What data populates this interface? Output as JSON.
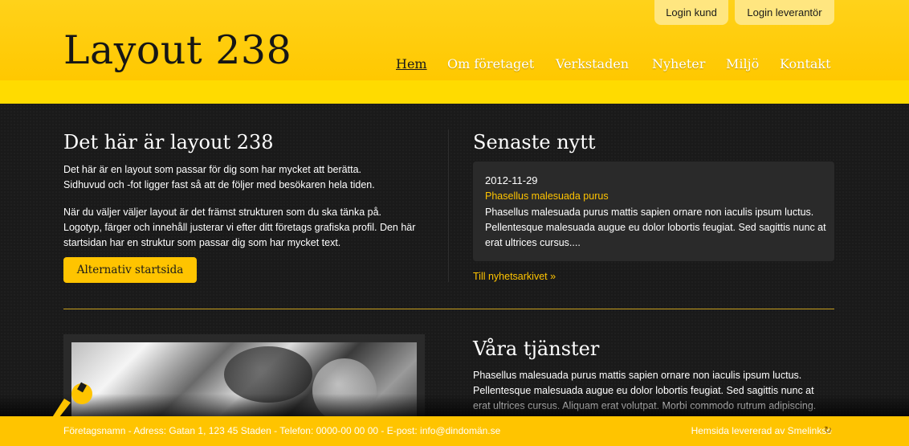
{
  "header": {
    "logo": "Layout 238",
    "login_kund": "Login kund",
    "login_leverantor": "Login leverantör",
    "nav": [
      "Hem",
      "Om företaget",
      "Verkstaden",
      "Nyheter",
      "Miljö",
      "Kontakt"
    ],
    "active_nav": "Hem"
  },
  "intro": {
    "title": "Det här är layout 238",
    "para1": "Det här är en layout som passar för dig som har mycket att berätta. Sidhuvud och -fot ligger fast så att de följer med besökaren hela tiden.",
    "para2": "När du väljer väljer layout är det främst strukturen som du ska tänka på. Logotyp, färger och innehåll justerar vi efter ditt företags grafiska profil. Den här startsidan har en struktur som passar dig som har mycket text.",
    "button": "Alternativ startsida"
  },
  "news": {
    "title": "Senaste nytt",
    "date": "2012-11-29",
    "headline": "Phasellus malesuada purus",
    "text": "Phasellus malesuada purus mattis sapien ornare non iaculis ipsum luctus. Pellentesque malesuada augue eu dolor lobortis feugiat. Sed sagittis nunc at erat ultrices cursus....",
    "archive_link": "Till nyhetsarkivet »"
  },
  "services": {
    "title": "Våra tjänster",
    "text": "Phasellus malesuada purus mattis sapien ornare non iaculis ipsum luctus. Pellentesque malesuada augue eu dolor lobortis feugiat. Sed sagittis nunc at erat ultrices cursus. Aliquam erat volutpat. Morbi commodo rutrum adipiscing."
  },
  "footer": {
    "info": "Företagsnamn - Adress: Gatan 1, 123 45 Staden - Telefon: 0000-00 00 00 - E-post: info@dindomän.se",
    "credit": "Hemsida levererad av Smelinkse"
  },
  "colors": {
    "accent": "#ffc400",
    "header": "#ffd21a",
    "background": "#1b1b1b"
  }
}
